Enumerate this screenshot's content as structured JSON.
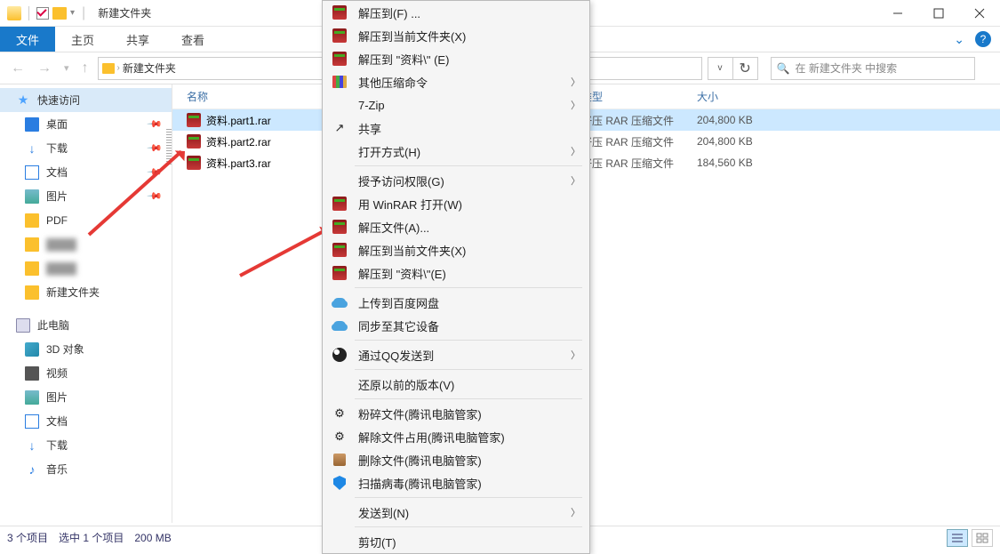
{
  "titlebar": {
    "title": "新建文件夹"
  },
  "ribbon": {
    "file": "文件",
    "tabs": [
      "主页",
      "共享",
      "查看"
    ]
  },
  "nav": {
    "crumb_root": "新建文件夹",
    "refresh": "↻"
  },
  "search": {
    "placeholder": "在 新建文件夹 中搜索"
  },
  "sidebar": {
    "quick": "快速访问",
    "items": [
      {
        "label": "桌面",
        "pin": true,
        "ico": "desktop"
      },
      {
        "label": "下载",
        "pin": true,
        "ico": "dl"
      },
      {
        "label": "文档",
        "pin": true,
        "ico": "doc"
      },
      {
        "label": "图片",
        "pin": true,
        "ico": "pic"
      },
      {
        "label": "PDF",
        "pin": false,
        "ico": "folder"
      },
      {
        "label": "",
        "pin": false,
        "ico": "folder",
        "blur": true
      },
      {
        "label": "",
        "pin": false,
        "ico": "folder",
        "blur": true
      },
      {
        "label": "新建文件夹",
        "pin": false,
        "ico": "folder"
      }
    ],
    "pc": "此电脑",
    "pc_items": [
      {
        "label": "3D 对象",
        "ico": "3d"
      },
      {
        "label": "视频",
        "ico": "vid"
      },
      {
        "label": "图片",
        "ico": "pic"
      },
      {
        "label": "文档",
        "ico": "doc"
      },
      {
        "label": "下载",
        "ico": "dl"
      },
      {
        "label": "音乐",
        "ico": "music"
      }
    ]
  },
  "cols": {
    "name": "名称",
    "type": "类型",
    "size": "大小"
  },
  "files": [
    {
      "name": "资料.part1.rar",
      "type": "好压 RAR 压缩文件",
      "size": "204,800 KB",
      "sel": true
    },
    {
      "name": "资料.part2.rar",
      "type": "好压 RAR 压缩文件",
      "size": "204,800 KB",
      "sel": false
    },
    {
      "name": "资料.part3.rar",
      "type": "好压 RAR 压缩文件",
      "size": "184,560 KB",
      "sel": false
    }
  ],
  "status": {
    "count": "3 个项目",
    "selected": "选中 1 个项目",
    "size": "200 MB"
  },
  "ctx": {
    "g1": [
      {
        "label": "解压到(F) ...",
        "ico": "rar"
      },
      {
        "label": "解压到当前文件夹(X)",
        "ico": "rar"
      },
      {
        "label": "解压到 \"资料\\\" (E)",
        "ico": "rar"
      },
      {
        "label": "其他压缩命令",
        "ico": "books",
        "sub": true
      },
      {
        "label": "7-Zip",
        "ico": "",
        "sub": true
      },
      {
        "label": "共享",
        "ico": "share"
      },
      {
        "label": "打开方式(H)",
        "ico": "",
        "sub": true
      }
    ],
    "g2": [
      {
        "label": "授予访问权限(G)",
        "ico": "",
        "sub": true
      },
      {
        "label": "用 WinRAR 打开(W)",
        "ico": "rar"
      },
      {
        "label": "解压文件(A)...",
        "ico": "rar"
      },
      {
        "label": "解压到当前文件夹(X)",
        "ico": "rar"
      },
      {
        "label": "解压到 \"资料\\\"(E)",
        "ico": "rar"
      }
    ],
    "g3": [
      {
        "label": "上传到百度网盘",
        "ico": "cloud"
      },
      {
        "label": "同步至其它设备",
        "ico": "cloud"
      }
    ],
    "g4": [
      {
        "label": "通过QQ发送到",
        "ico": "qq",
        "sub": true
      }
    ],
    "g5": [
      {
        "label": "还原以前的版本(V)",
        "ico": ""
      }
    ],
    "g6": [
      {
        "label": "粉碎文件(腾讯电脑管家)",
        "ico": "gear"
      },
      {
        "label": "解除文件占用(腾讯电脑管家)",
        "ico": "gear"
      },
      {
        "label": "删除文件(腾讯电脑管家)",
        "ico": "broom"
      },
      {
        "label": "扫描病毒(腾讯电脑管家)",
        "ico": "shield"
      }
    ],
    "g7": [
      {
        "label": "发送到(N)",
        "ico": "",
        "sub": true
      }
    ],
    "g8": [
      {
        "label": "剪切(T)",
        "ico": ""
      }
    ]
  }
}
